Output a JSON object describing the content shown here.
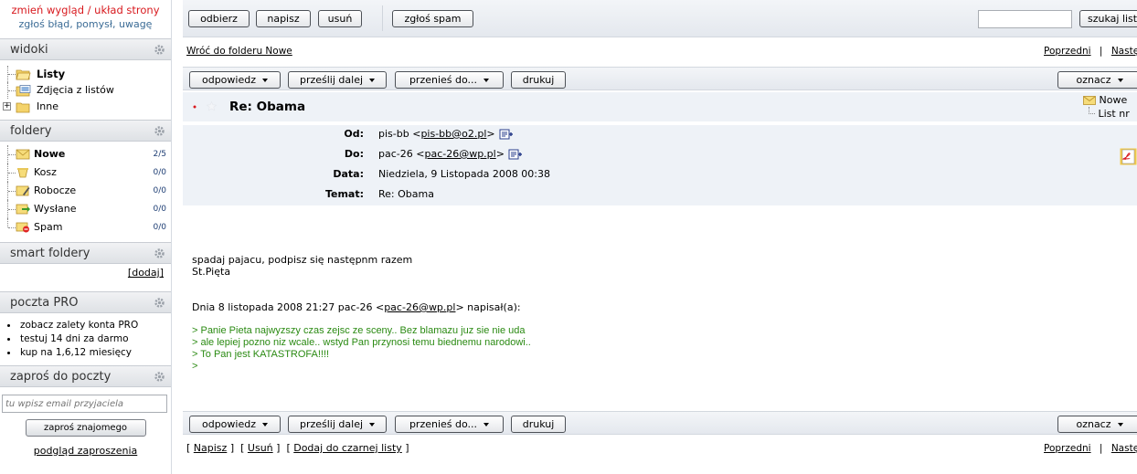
{
  "sidebar": {
    "top_links": [
      "zmień wygląd / układ strony",
      "zgłoś błąd, pomysł, uwagę"
    ],
    "views": {
      "title": "widoki",
      "items": [
        "Listy",
        "Zdjęcia z listów",
        "Inne"
      ]
    },
    "folders": {
      "title": "foldery",
      "items": [
        {
          "name": "Nowe",
          "count": "2/5"
        },
        {
          "name": "Kosz",
          "count": "0/0"
        },
        {
          "name": "Robocze",
          "count": "0/0"
        },
        {
          "name": "Wysłane",
          "count": "0/0"
        },
        {
          "name": "Spam",
          "count": "0/0"
        }
      ]
    },
    "smart_folders": {
      "title": "smart foldery",
      "add_link": "[dodaj]"
    },
    "pro": {
      "title": "poczta PRO",
      "items": [
        "zobacz zalety konta PRO",
        "testuj 14 dni za darmo",
        "kup na 1,6,12 miesięcy"
      ]
    },
    "invite": {
      "title": "zaproś do poczty",
      "placeholder": "tu wpisz email przyjaciela",
      "button": "zaproś znajomego",
      "preview_link": "podgląd zaproszenia"
    }
  },
  "toolbar": {
    "receive": "odbierz",
    "compose": "napisz",
    "delete": "usuń",
    "report_spam": "zgłoś spam",
    "search_button": "szukaj listu"
  },
  "nav": {
    "back_link": "Wróć do folderu Nowe",
    "prev": "Poprzedni",
    "sep": "|",
    "next": "Następny"
  },
  "actions": {
    "reply": "odpowiedz",
    "forward": "prześlij dalej",
    "move": "przenieś do...",
    "print": "drukuj",
    "mark": "oznacz"
  },
  "message": {
    "subject": "Re: Obama",
    "tree": [
      "Nowe",
      "List nr"
    ],
    "header_labels": [
      "Od:",
      "Do:",
      "Data:",
      "Temat:"
    ],
    "from_name": "pis-bb",
    "from_email": "pis-bb@o2.pl",
    "to_name": "pac-26",
    "to_email": "pac-26@wp.pl",
    "date": "Niedziela, 9 Listopada 2008 00:38",
    "subject_value": "Re: Obama",
    "body_lines": [
      "spadaj pajacu, podpisz się następnm razem",
      "St.Pięta"
    ],
    "quote_intro_pre": "Dnia 8 listopada 2008 21:27 pac-26 <",
    "quote_intro_email": "pac-26@wp.pl",
    "quote_intro_post": "> napisał(a):",
    "quote_lines": [
      "> Panie Pieta najwyzszy czas zejsc ze sceny.. Bez blamazu juz sie nie uda",
      "> ale lepiej pozno niz wcale.. wstyd Pan przynosi temu biednemu narodowi..",
      "> To Pan jest KATASTROFA!!!!",
      ">"
    ]
  },
  "footer": {
    "compose_link": "Napisz",
    "delete_link": "Usuń",
    "blacklist_link": "Dodaj do czarnej listy",
    "open": "[",
    "close": "]"
  },
  "colors": {
    "top_link_red": "#d8191e",
    "top_link_blue": "#3c6c96",
    "quote_green": "#2a8a12",
    "count_blue": "#1e3e74"
  }
}
